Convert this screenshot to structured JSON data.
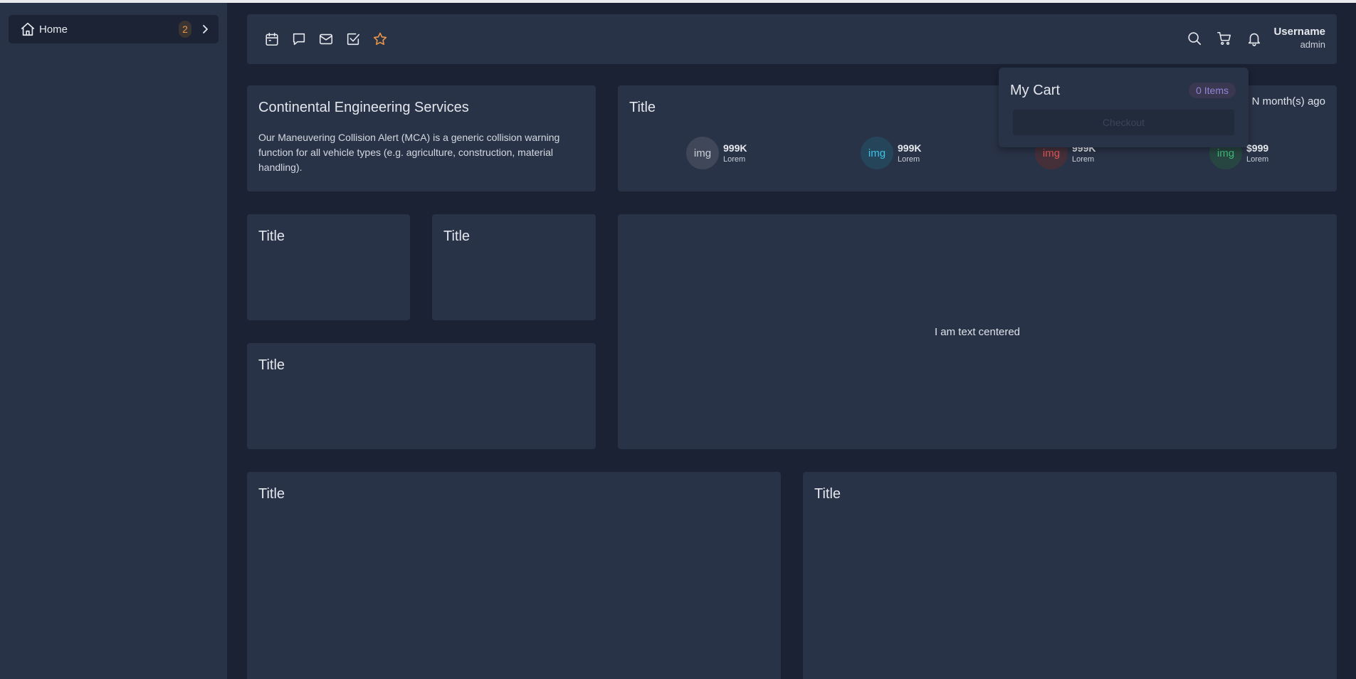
{
  "sidebar": {
    "items": [
      {
        "label": "Home",
        "badge": "2",
        "icon": "home-icon"
      }
    ]
  },
  "topbar": {
    "left_icons": [
      "calendar-icon",
      "chat-icon",
      "mail-icon",
      "checkbox-icon",
      "star-icon"
    ],
    "right_icons": [
      "search-icon",
      "cart-icon",
      "bell-icon"
    ],
    "user": {
      "name": "Username",
      "role": "admin"
    }
  },
  "cards": {
    "company": {
      "title": "Continental Engineering Services",
      "description": "Our Maneuvering Collision Alert (MCA) is a generic collision warning function for all vehicle types (e.g. agriculture, construction, material handling)."
    },
    "stats_card": {
      "title": "Title",
      "updated": "e N month(s) ago",
      "stats": [
        {
          "img": "img",
          "value": "999K",
          "sub": "Lorem",
          "color": "#c9cfd8",
          "bg": "#3f4758"
        },
        {
          "img": "img",
          "value": "999K",
          "sub": "Lorem",
          "color": "#3ec3e6",
          "bg": "#24455a"
        },
        {
          "img": "img",
          "value": "999K",
          "sub": "Lorem",
          "color": "#e25a5a",
          "bg": "#45303a"
        },
        {
          "img": "img",
          "value": "$999",
          "sub": "Lorem",
          "color": "#3fbf7a",
          "bg": "#274641"
        }
      ]
    },
    "small_a": {
      "title": "Title"
    },
    "small_b": {
      "title": "Title"
    },
    "mid": {
      "title": "Title"
    },
    "big": {
      "text": "I am text centered"
    },
    "bottom_left": {
      "title": "Title"
    },
    "bottom_right": {
      "title": "Title"
    }
  },
  "cart_dropdown": {
    "title": "My Cart",
    "badge": "0 Items",
    "button": "Checkout"
  },
  "colors": {
    "accent_orange": "#e8954a",
    "background": "#1a2234",
    "card": "#293347"
  }
}
